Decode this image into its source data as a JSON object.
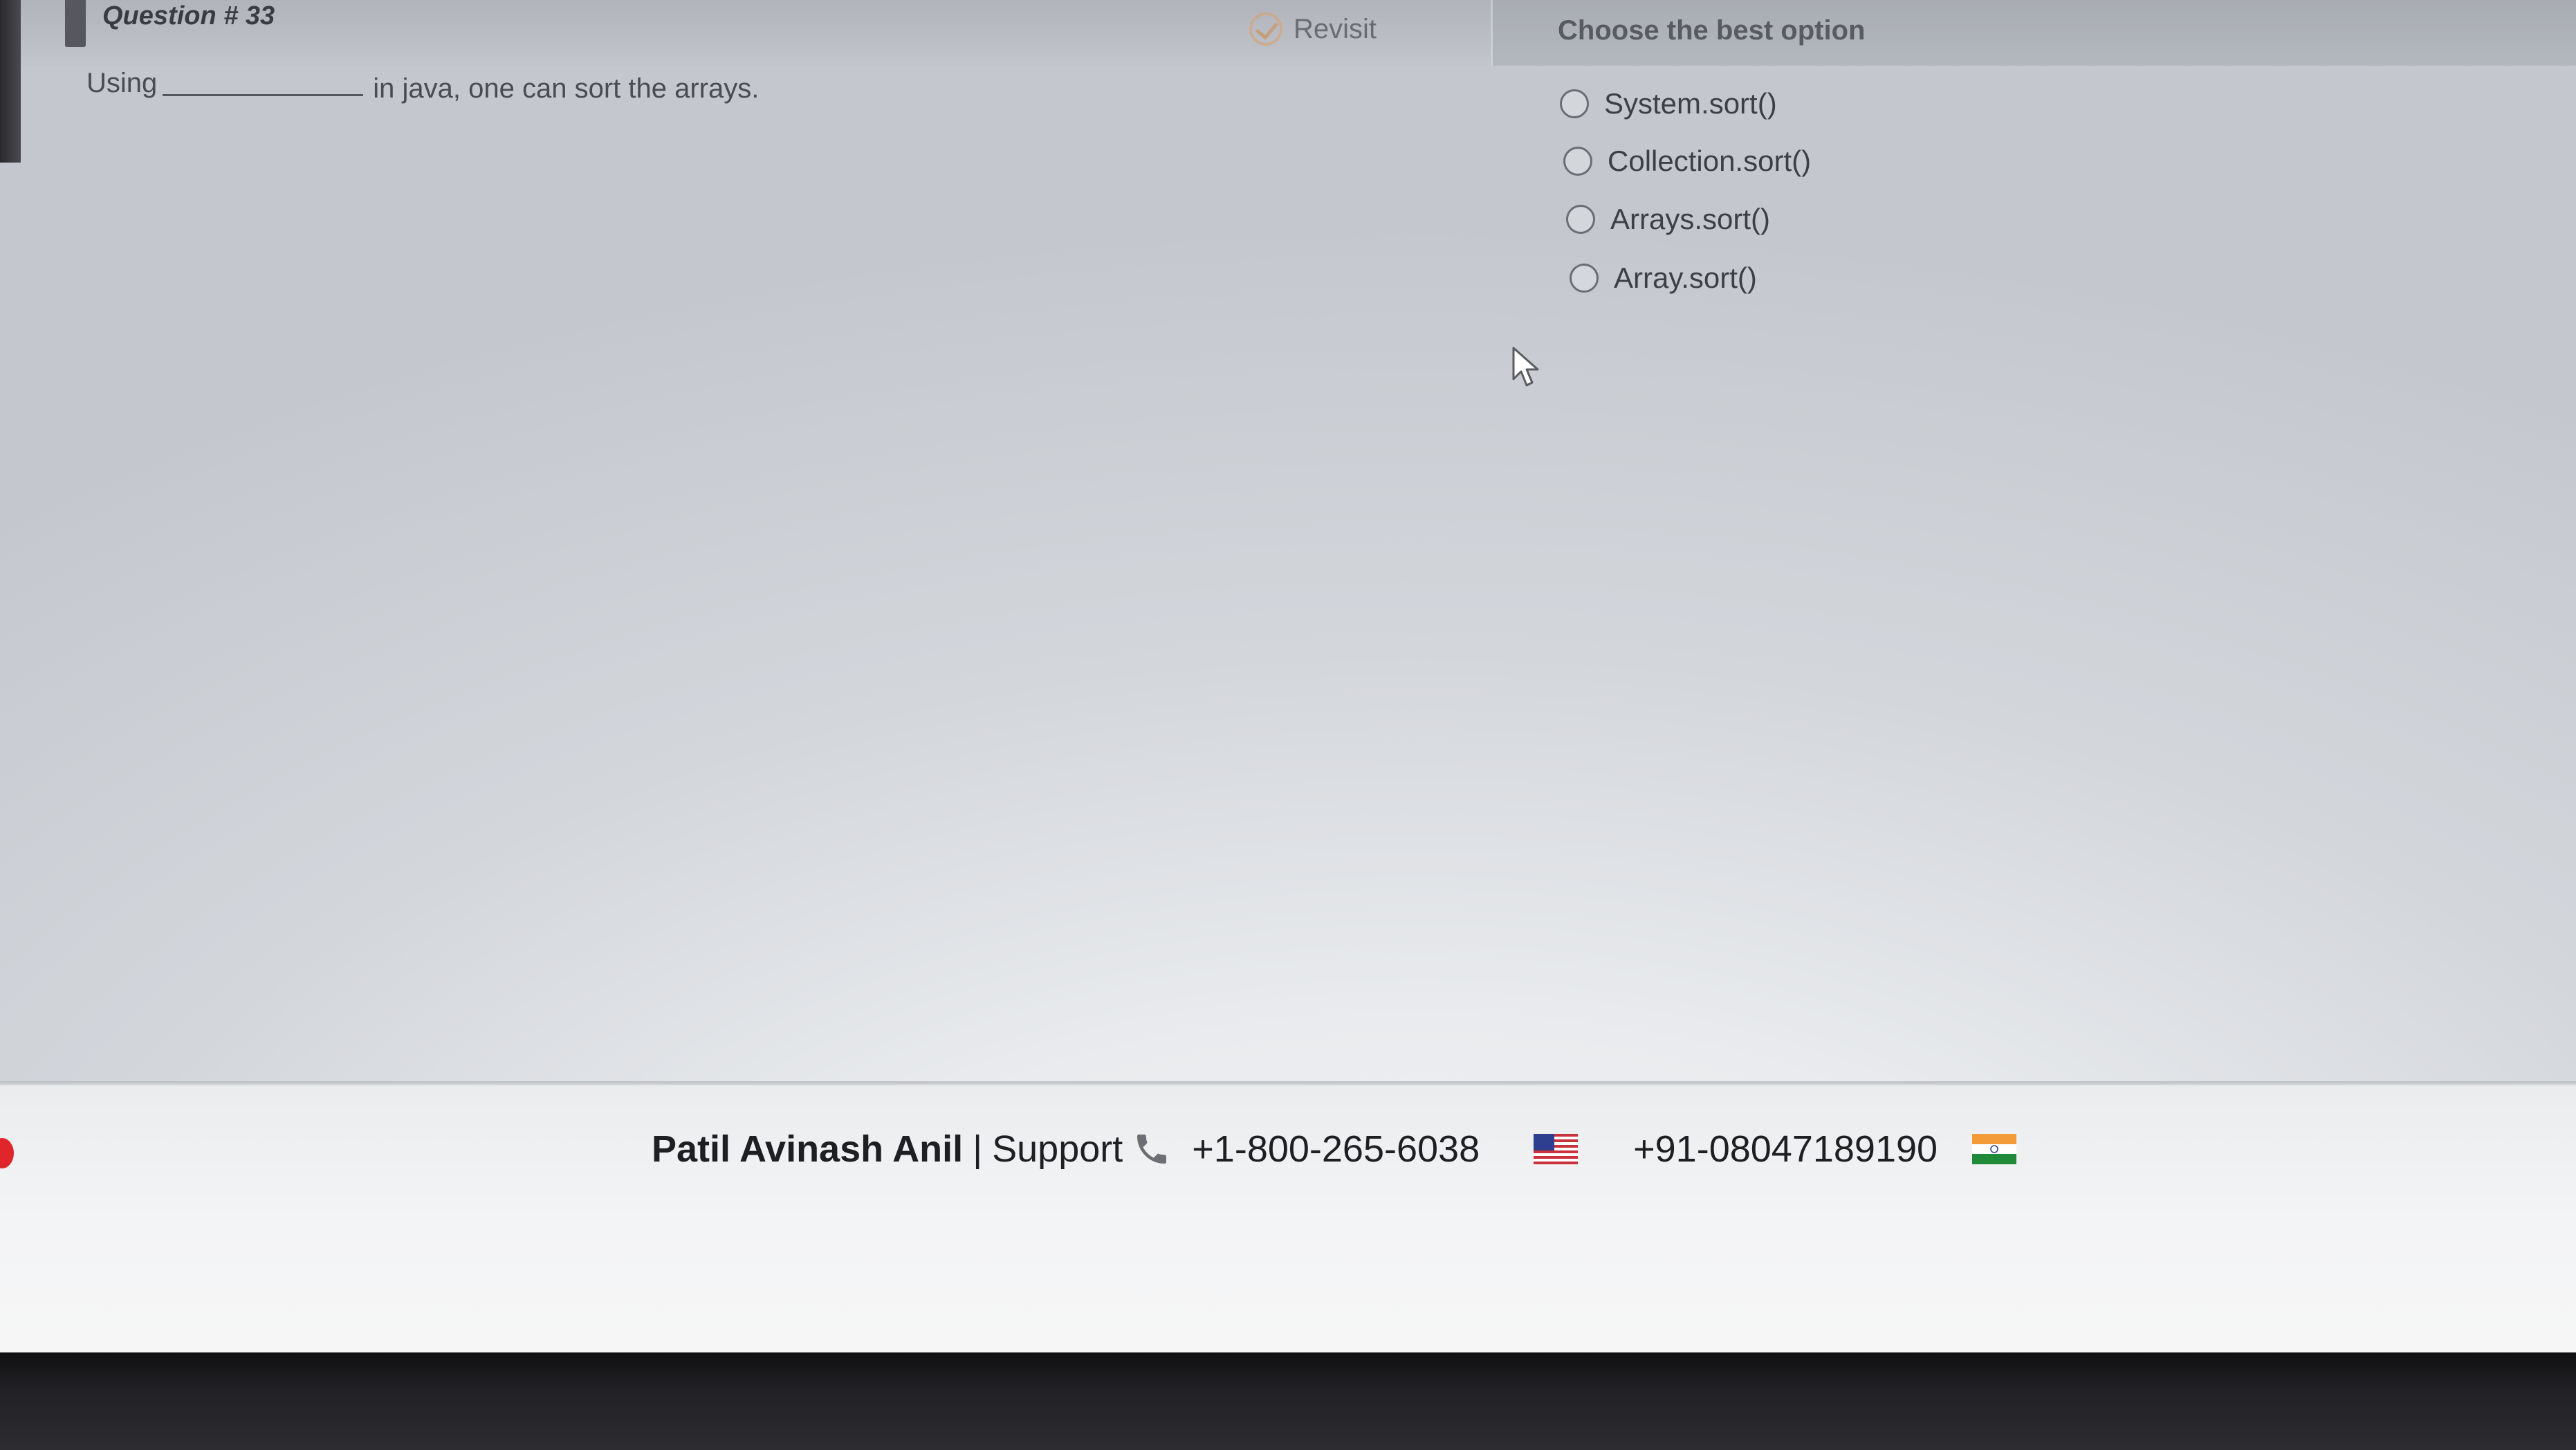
{
  "question": {
    "title": "Question # 33",
    "prefix": "Using",
    "suffix": "in java, one can sort the arrays."
  },
  "revisit": {
    "label": "Revisit"
  },
  "answers": {
    "heading": "Choose the best option",
    "options": [
      "System.sort()",
      "Collection.sort()",
      "Arrays.sort()",
      "Array.sort()"
    ]
  },
  "footer": {
    "name": "Patil Avinash Anil",
    "separator": "|",
    "support_label": "Support",
    "us_phone": "+1-800-265-6038",
    "india_phone": "+91-08047189190"
  },
  "colors": {
    "revisit_accent": "#d08a44",
    "india_saffron": "#f29b38",
    "india_green": "#1f8a3a",
    "us_red": "#c8323c",
    "us_blue": "#2f3f8f"
  },
  "icons": {
    "revisit": "check-circle-icon",
    "phone": "phone-icon",
    "us_flag": "us-flag-icon",
    "india_flag": "india-flag-icon",
    "cursor": "mouse-cursor-icon"
  }
}
